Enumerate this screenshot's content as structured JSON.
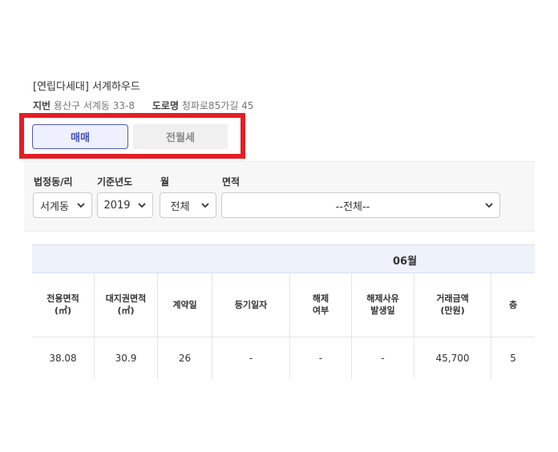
{
  "property": {
    "title": "[연립다세대] 서계하우드",
    "jibun_label": "지번",
    "jibun_value": "용산구 서계동 33-8",
    "road_label": "도로명",
    "road_value": "청파로85가길 45"
  },
  "tabs": [
    {
      "label": "매매",
      "active": true
    },
    {
      "label": "전월세",
      "active": false
    }
  ],
  "filters": {
    "dong": {
      "label": "법정동/리",
      "value": "서계동"
    },
    "year": {
      "label": "기준년도",
      "value": "2019"
    },
    "month": {
      "label": "월",
      "value": "전체"
    },
    "area": {
      "label": "면적",
      "value": "--전체--"
    }
  },
  "table": {
    "month_header": "06월",
    "columns": [
      "전용면적\n(㎡)",
      "대지권면적\n(㎡)",
      "계약일",
      "등기일자",
      "해제\n여부",
      "해제사유\n발생일",
      "거래금액\n(만원)",
      "층"
    ],
    "rows": [
      [
        "38.08",
        "30.9",
        "26",
        "-",
        "-",
        "-",
        "45,700",
        "5"
      ]
    ]
  },
  "colors": {
    "accent": "#4350b5",
    "highlight": "#e41e25",
    "header_bg": "#eef2fb"
  }
}
